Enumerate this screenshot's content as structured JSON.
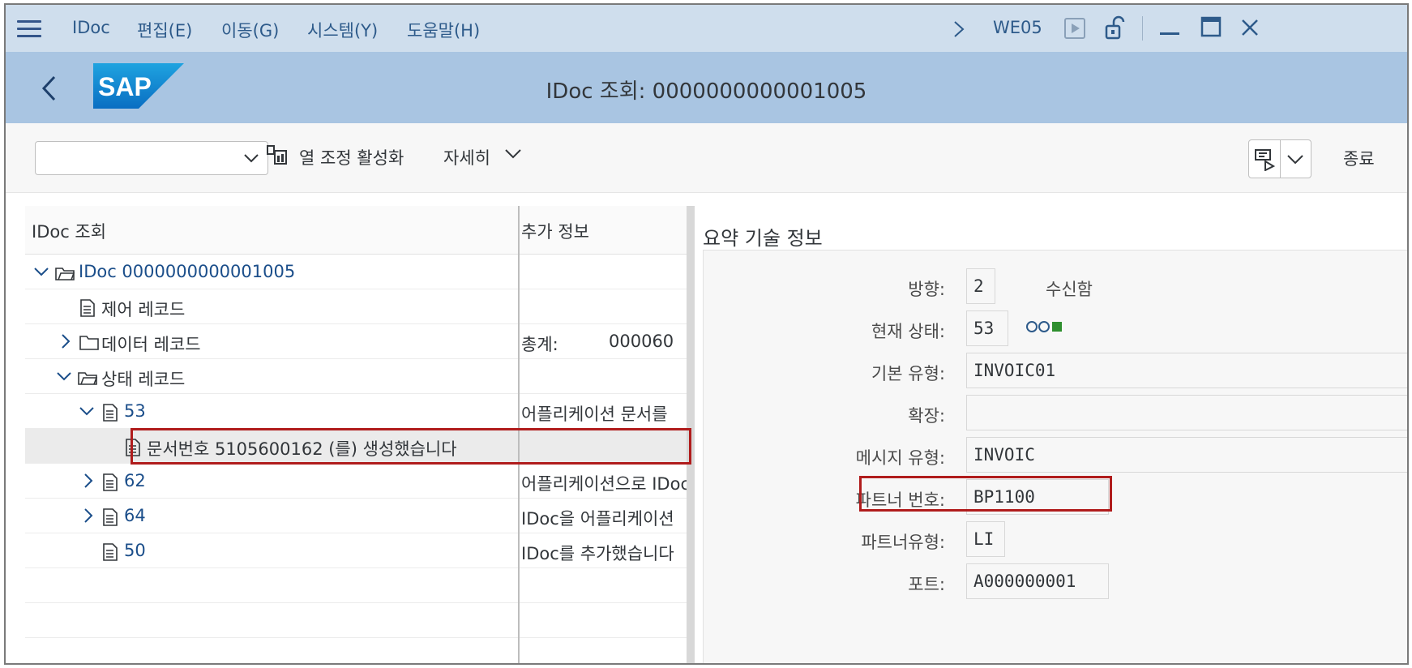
{
  "menu": {
    "items": [
      "IDoc",
      "편집(E)",
      "이동(G)",
      "시스템(Y)",
      "도움말(H)"
    ],
    "transaction": "WE05"
  },
  "title": "IDoc 조회: 0000000000001005",
  "toolbar": {
    "column_toggle": "열 조정 활성화",
    "more": "자세히",
    "exit": "종료"
  },
  "tree": {
    "headers": [
      "IDoc 조회",
      "추가 정보"
    ],
    "rows": [
      {
        "label": "IDoc 0000000000001005",
        "info": ""
      },
      {
        "label": "제어 레코드",
        "info": ""
      },
      {
        "label": "데이터 레코드",
        "info_key": "총계:",
        "info_val": "000060"
      },
      {
        "label": "상태 레코드",
        "info": ""
      },
      {
        "label": "53",
        "info": "어플리케이션 문서를"
      },
      {
        "label": "문서번호 5105600162 (를) 생성했습니다",
        "info": ""
      },
      {
        "label": "62",
        "info": "어플리케이션으로 IDoc"
      },
      {
        "label": "64",
        "info": "IDoc을 어플리케이션"
      },
      {
        "label": "50",
        "info": "IDoc를 추가했습니다"
      }
    ]
  },
  "summary": {
    "title": "요약 기술 정보",
    "direction_label": "방향:",
    "direction_value": "2",
    "direction_text": "수신함",
    "status_label": "현재 상태:",
    "status_value": "53",
    "basic_type_label": "기본 유형:",
    "basic_type_value": "INVOIC01",
    "extension_label": "확장:",
    "extension_value": "",
    "message_type_label": "메시지 유형:",
    "message_type_value": "INVOIC",
    "partner_no_label": "파트너 번호:",
    "partner_no_value": "BP1100",
    "partner_type_label": "파트너유형:",
    "partner_type_value": "LI",
    "port_label": "포트:",
    "port_value": "A000000001"
  },
  "colors": {
    "menubar": "#cfdeed",
    "titlebar": "#a9c5e2",
    "link": "#1b4e8a",
    "highlight": "#b01c1c",
    "status_green": "#2f8f2f"
  }
}
